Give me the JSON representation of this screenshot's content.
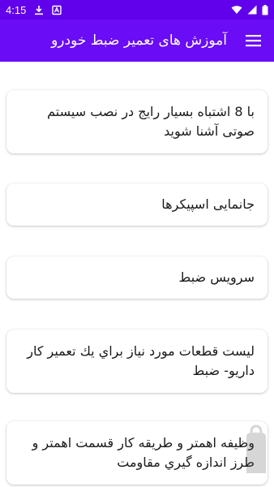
{
  "status_bar": {
    "time": "4:15",
    "icons": [
      "download-icon",
      "app-store-icon",
      "wifi-icon",
      "signal-icon",
      "battery-icon"
    ]
  },
  "app_bar": {
    "title": "آموزش های تعمیر ضبط خودرو",
    "menu_icon": "hamburger-menu-icon"
  },
  "items": [
    {
      "label": "با 8 اشتباه بسيار رايج در نصب سيستم صوتی آشنا شويد"
    },
    {
      "label": "جانمایی اسپیکرها"
    },
    {
      "label": "سرويس ضبط"
    },
    {
      "label": "ليست قطعات مورد نياز براي يك تعمير كار داريو- ضبط"
    },
    {
      "label": "وظيفه اهمتر و طريقه كار قسمت اهمتر و طرز اندازه گيري مقاومت"
    }
  ],
  "colors": {
    "status_bar": "#6100ea",
    "app_bar": "#6a0cf5",
    "card_background": "#ffffff",
    "text": "#1a1a1a"
  }
}
